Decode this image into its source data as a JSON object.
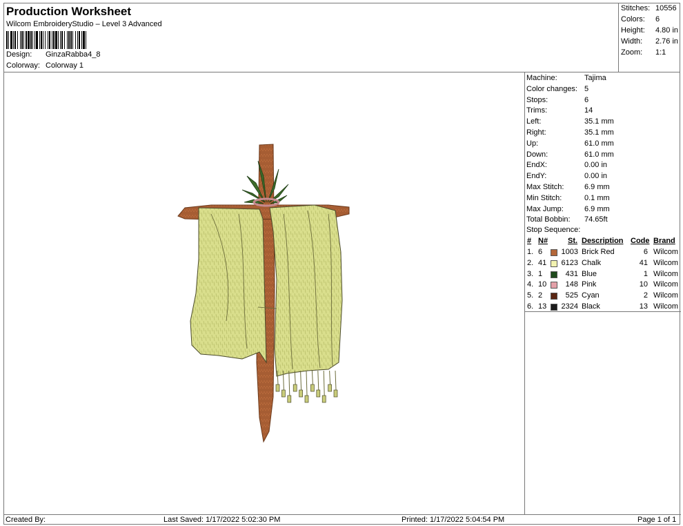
{
  "header": {
    "title": "Production Worksheet",
    "subtitle": "Wilcom EmbroideryStudio – Level 3 Advanced",
    "design_label": "Design:",
    "design_value": "GinzaRabba4_8",
    "colorway_label": "Colorway:",
    "colorway_value": "Colorway 1"
  },
  "summary": [
    {
      "label": "Stitches:",
      "value": "10556"
    },
    {
      "label": "Colors:",
      "value": "6"
    },
    {
      "label": "Height:",
      "value": "4.80 in"
    },
    {
      "label": "Width:",
      "value": "2.76 in"
    },
    {
      "label": "Zoom:",
      "value": "1:1"
    }
  ],
  "machine_info": [
    {
      "label": "Machine:",
      "value": "Tajima"
    },
    {
      "label": "Color changes:",
      "value": "5"
    },
    {
      "label": "Stops:",
      "value": "6"
    },
    {
      "label": "Trims:",
      "value": "14"
    },
    {
      "label": "Left:",
      "value": "35.1 mm"
    },
    {
      "label": "Right:",
      "value": "35.1 mm"
    },
    {
      "label": "Up:",
      "value": "61.0 mm"
    },
    {
      "label": "Down:",
      "value": "61.0 mm"
    },
    {
      "label": "EndX:",
      "value": "0.00 in"
    },
    {
      "label": "EndY:",
      "value": "0.00 in"
    },
    {
      "label": "Max Stitch:",
      "value": "6.9 mm"
    },
    {
      "label": "Min Stitch:",
      "value": "0.1 mm"
    },
    {
      "label": "Max Jump:",
      "value": "6.9 mm"
    },
    {
      "label": "Total Bobbin:",
      "value": "74.65ft"
    }
  ],
  "stop_sequence": {
    "heading": "Stop Sequence:",
    "columns": {
      "index": "#",
      "n": "N#",
      "st": "St.",
      "description": "Description",
      "code": "Code",
      "brand": "Brand"
    },
    "rows": [
      {
        "index": "1.",
        "n": "6",
        "st": "1003",
        "description": "Brick Red",
        "code": "6",
        "brand": "Wilcom",
        "color": "#b4673a"
      },
      {
        "index": "2.",
        "n": "41",
        "st": "6123",
        "description": "Chalk",
        "code": "41",
        "brand": "Wilcom",
        "color": "#f2f2b0"
      },
      {
        "index": "3.",
        "n": "1",
        "st": "431",
        "description": "Blue",
        "code": "1",
        "brand": "Wilcom",
        "color": "#1f4a1c"
      },
      {
        "index": "4.",
        "n": "10",
        "st": "148",
        "description": "Pink",
        "code": "10",
        "brand": "Wilcom",
        "color": "#e3a0a8"
      },
      {
        "index": "5.",
        "n": "2",
        "st": "525",
        "description": "Cyan",
        "code": "2",
        "brand": "Wilcom",
        "color": "#5a2612"
      },
      {
        "index": "6.",
        "n": "13",
        "st": "2324",
        "description": "Black",
        "code": "13",
        "brand": "Wilcom",
        "color": "#1c1c1c"
      }
    ]
  },
  "footer": {
    "created_by": "Created By:",
    "last_saved": "Last Saved: 1/17/2022 5:02:30 PM",
    "printed": "Printed: 1/17/2022 5:04:54 PM",
    "page": "Page 1 of 1"
  },
  "colors": {
    "wood": "#b4673a",
    "cloth": "#d9de8c",
    "leaf": "#3d6b2a"
  }
}
